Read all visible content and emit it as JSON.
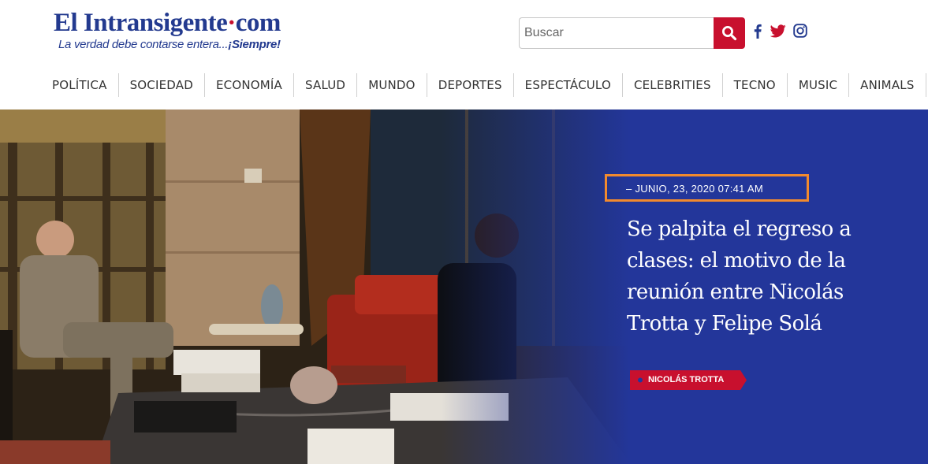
{
  "site": {
    "logo_name": "El Intransigente",
    "logo_dot": "·",
    "logo_suffix": "com",
    "tagline_start": "La verdad debe contarse entera...",
    "tagline_end": "¡Siempre!"
  },
  "search": {
    "placeholder": "Buscar",
    "value": "",
    "button_icon": "search-icon"
  },
  "social": [
    {
      "name": "facebook-icon"
    },
    {
      "name": "twitter-icon"
    },
    {
      "name": "instagram-icon"
    }
  ],
  "nav": [
    {
      "label": "POLÍTICA"
    },
    {
      "label": "SOCIEDAD"
    },
    {
      "label": "ECONOMÍA"
    },
    {
      "label": "SALUD"
    },
    {
      "label": "MUNDO"
    },
    {
      "label": "DEPORTES"
    },
    {
      "label": "ESPECTÁCULO"
    },
    {
      "label": "CELEBRITIES"
    },
    {
      "label": "TECNO"
    },
    {
      "label": "MUSIC"
    },
    {
      "label": "ANIMALS"
    }
  ],
  "article": {
    "date": "– JUNIO, 23, 2020 07:41 AM",
    "title": "Se palpita el regreso a clases: el motivo de la reunión entre Nicolás Trotta y Felipe Solá",
    "tag": "NICOLÁS TROTTA"
  },
  "colors": {
    "brand_blue": "#233a8f",
    "accent_red": "#c8102e",
    "hero_blue": "#23369a",
    "highlight_orange": "#f28a2e"
  }
}
